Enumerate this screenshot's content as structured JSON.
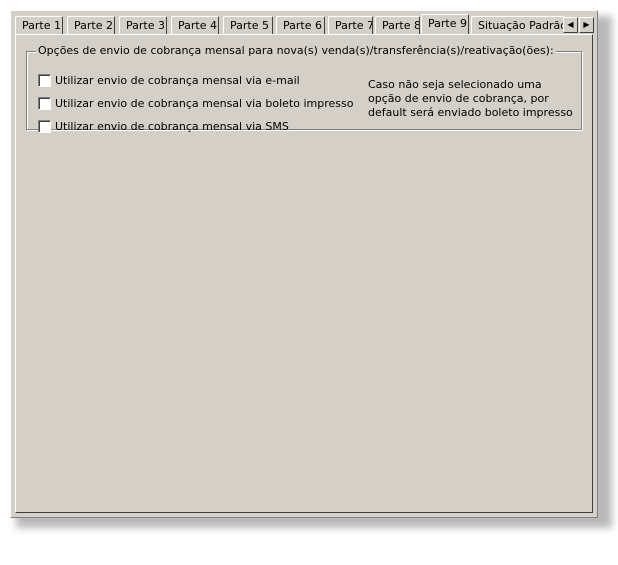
{
  "tabs": [
    {
      "label": "Parte 1",
      "active": false
    },
    {
      "label": "Parte 2",
      "active": false
    },
    {
      "label": "Parte 3",
      "active": false
    },
    {
      "label": "Parte 4",
      "active": false
    },
    {
      "label": "Parte 5",
      "active": false
    },
    {
      "label": "Parte 6",
      "active": false
    },
    {
      "label": "Parte 7",
      "active": false
    },
    {
      "label": "Parte 8",
      "active": false
    },
    {
      "label": "Parte 9",
      "active": true
    },
    {
      "label": "Situação Padrão N",
      "active": false
    }
  ],
  "tab_scroll": {
    "left_icon": "scroll-left-arrow",
    "right_icon": "scroll-right-arrow",
    "left_glyph": "◀",
    "right_glyph": "▶"
  },
  "group": {
    "title": "Opções de envio de cobrança mensal para nova(s) venda(s)/transferência(s)/reativação(ões):",
    "options": [
      {
        "label": "Utilizar envio de cobrança mensal via e-mail",
        "checked": false
      },
      {
        "label": "Utilizar envio de cobrança mensal via boleto impresso",
        "checked": false
      },
      {
        "label": "Utilizar envio de cobrança mensal via SMS",
        "checked": false
      }
    ],
    "note": "Caso não seja selecionado uma opção de envio de cobrança, por default será enviado boleto impresso"
  },
  "colors": {
    "face": "#d4d0c8",
    "highlight": "#ffffff",
    "shadow": "#808080"
  }
}
